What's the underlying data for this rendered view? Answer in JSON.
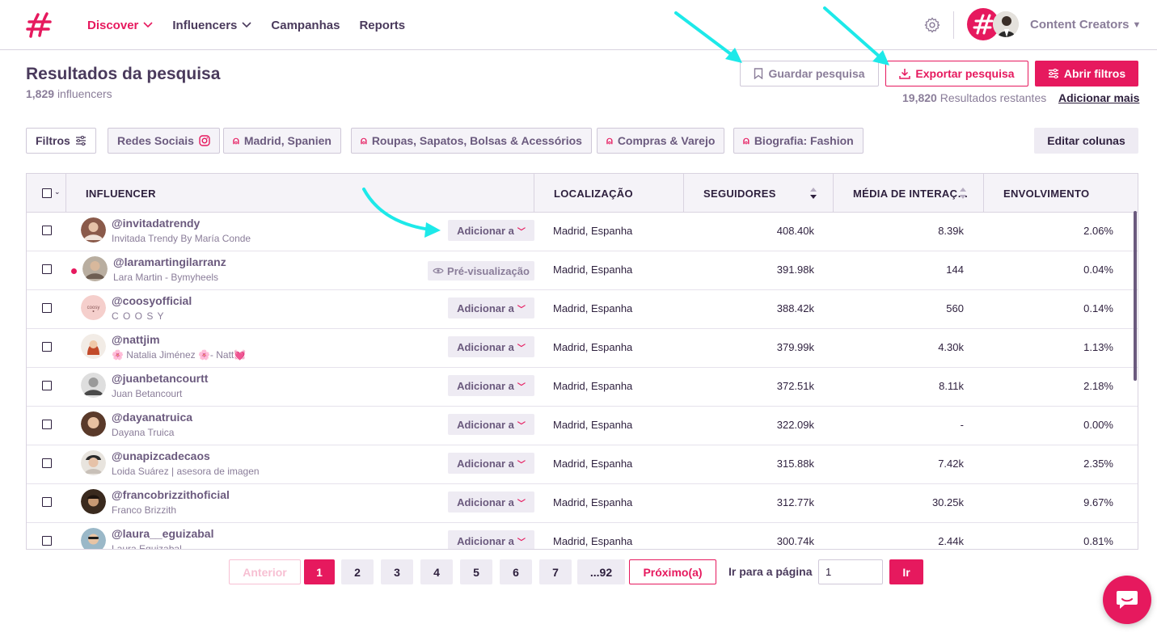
{
  "nav": {
    "items": [
      {
        "label": "Discover",
        "active": true,
        "dropdown": true
      },
      {
        "label": "Influencers",
        "active": false,
        "dropdown": true
      },
      {
        "label": "Campanhas",
        "active": false,
        "dropdown": false
      },
      {
        "label": "Reports",
        "active": false,
        "dropdown": false
      }
    ],
    "account": "Content Creators"
  },
  "header": {
    "title": "Resultados da pesquisa",
    "count": "1,829",
    "count_suffix": "influencers",
    "save_label": "Guardar pesquisa",
    "export_label": "Exportar pesquisa",
    "filters_label": "Abrir filtros",
    "remaining_count": "19,820",
    "remaining_label": "Resultados restantes",
    "add_more": "Adicionar mais"
  },
  "chips": {
    "filters": "Filtros",
    "social": "Redes Sociais",
    "location": "Madrid, Spanien",
    "category1": "Roupas, Sapatos, Bolsas & Acessórios",
    "category2": "Compras & Varejo",
    "bio": "Biografia: Fashion",
    "edit_columns": "Editar colunas"
  },
  "table": {
    "columns": [
      "INFLUENCER",
      "LOCALIZAÇÃO",
      "SEGUIDORES",
      "MÉDIA DE INTERAÇ…",
      "ENVOLVIMENTO"
    ],
    "add_label": "Adicionar a",
    "preview_label": "Pré-visualização",
    "rows": [
      {
        "handle": "@invitadatrendy",
        "name": "Invitada Trendy By María Conde",
        "location": "Madrid, Espanha",
        "followers": "408.40k",
        "avg": "8.39k",
        "engagement": "2.06%"
      },
      {
        "handle": "@laramartingilarranz",
        "name": "Lara Martin - Bymyheels",
        "location": "Madrid, Espanha",
        "followers": "391.98k",
        "avg": "144",
        "engagement": "0.04%"
      },
      {
        "handle": "@coosyofficial",
        "name": "C O O S Y",
        "location": "Madrid, Espanha",
        "followers": "388.42k",
        "avg": "560",
        "engagement": "0.14%"
      },
      {
        "handle": "@nattjim",
        "name": "🌸 Natalia Jiménez 🌸- Natt💓",
        "location": "Madrid, Espanha",
        "followers": "379.99k",
        "avg": "4.30k",
        "engagement": "1.13%"
      },
      {
        "handle": "@juanbetancourtt",
        "name": "Juan Betancourt",
        "location": "Madrid, Espanha",
        "followers": "372.51k",
        "avg": "8.11k",
        "engagement": "2.18%"
      },
      {
        "handle": "@dayanatruica",
        "name": "Dayana Truica",
        "location": "Madrid, Espanha",
        "followers": "322.09k",
        "avg": "-",
        "engagement": "0.00%"
      },
      {
        "handle": "@unapizcadecaos",
        "name": "Loida Suárez | asesora de imagen",
        "location": "Madrid, Espanha",
        "followers": "315.88k",
        "avg": "7.42k",
        "engagement": "2.35%"
      },
      {
        "handle": "@francobrizzithoficial",
        "name": "Franco Brizzith",
        "location": "Madrid, Espanha",
        "followers": "312.77k",
        "avg": "30.25k",
        "engagement": "9.67%"
      },
      {
        "handle": "@laura__eguizabal",
        "name": "Laura Eguizabal",
        "location": "Madrid, Espanha",
        "followers": "300.74k",
        "avg": "2.44k",
        "engagement": "0.81%"
      }
    ]
  },
  "pagination": {
    "prev": "Anterior",
    "pages": [
      "1",
      "2",
      "3",
      "4",
      "5",
      "6",
      "7",
      "...92"
    ],
    "current": "1",
    "next": "Próximo(a)",
    "goto_label": "Ir para a página",
    "goto_value": "1",
    "goto_button": "Ir"
  },
  "colors": {
    "brand": "#e6195e",
    "annotation_arrow": "#1de9e9"
  }
}
